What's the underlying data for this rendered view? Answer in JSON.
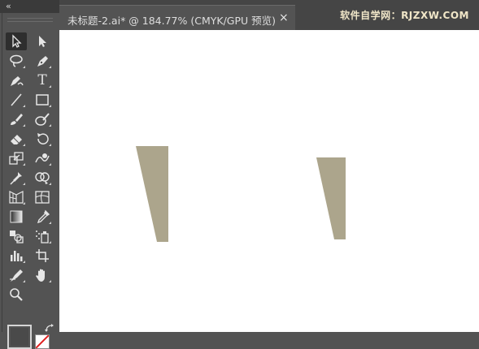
{
  "panel": {
    "collapse_glyph": "«"
  },
  "document": {
    "tab_title": "未标题-2.ai* @ 184.77% (CMYK/GPU 预览)",
    "close_glyph": "×"
  },
  "watermark": {
    "text": "软件自学网：RJZXW.COM"
  },
  "tools": {
    "type_letter": "T"
  },
  "colors": {
    "shape_fill": "#aca58c",
    "canvas": "#ffffff",
    "ui_dark": "#535353"
  },
  "icons": [
    "selection-tool-icon",
    "direct-selection-tool-icon",
    "lasso-tool-icon",
    "pen-tool-icon",
    "curvature-tool-icon",
    "type-tool-icon",
    "line-segment-tool-icon",
    "rectangle-tool-icon",
    "paintbrush-tool-icon",
    "blob-brush-tool-icon",
    "eraser-tool-icon",
    "rotate-tool-icon",
    "scale-tool-icon",
    "warp-tool-icon",
    "puppet-warp-tool-icon",
    "shape-builder-tool-icon",
    "perspective-grid-tool-icon",
    "mesh-tool-icon",
    "gradient-tool-icon",
    "eyedropper-tool-icon",
    "blend-tool-icon",
    "symbol-sprayer-tool-icon",
    "graph-tool-icon",
    "artboard-tool-icon",
    "slice-tool-icon",
    "hand-tool-icon",
    "zoom-tool-icon"
  ]
}
